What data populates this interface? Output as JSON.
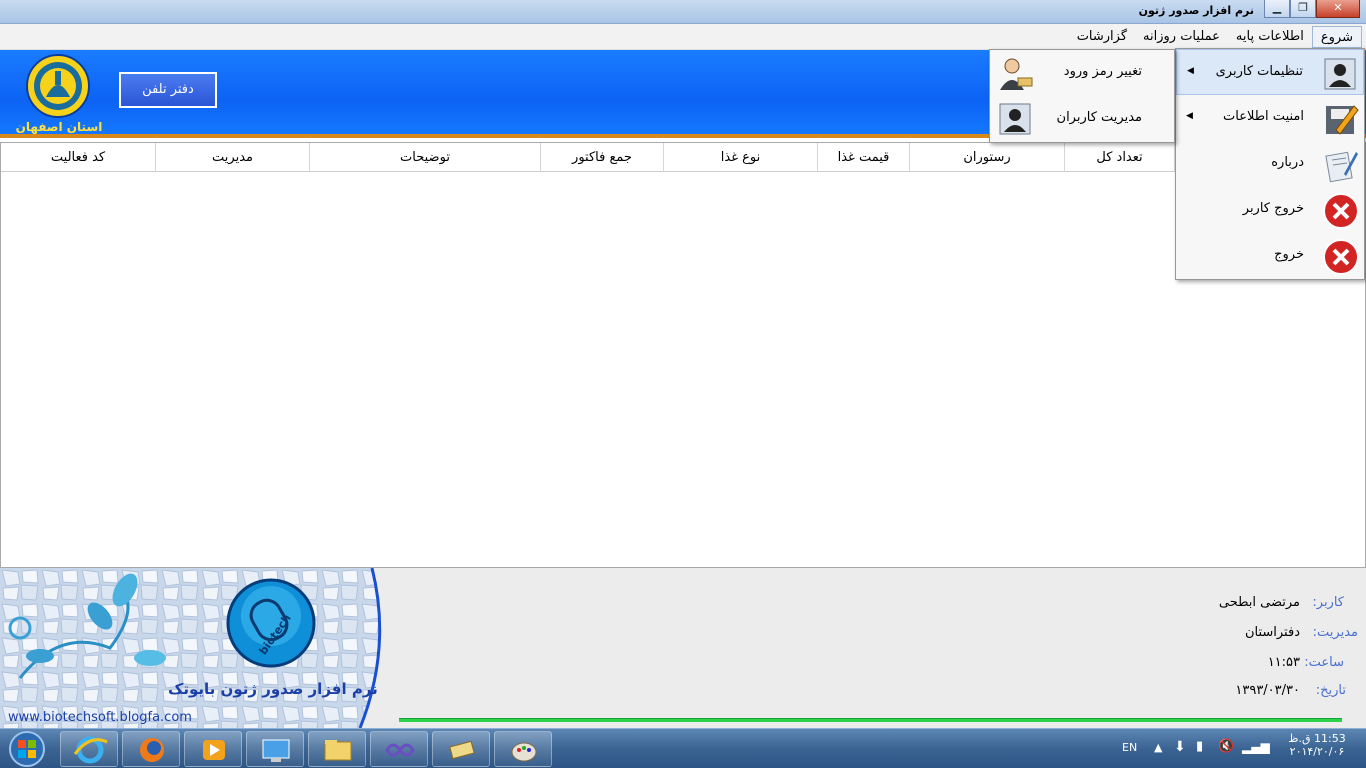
{
  "window": {
    "title": "نرم افزار صدور ژتون",
    "minimize_glyph": "▁",
    "maximize_glyph": "❐",
    "close_glyph": "✕"
  },
  "menubar": {
    "items": [
      {
        "label": "شروع"
      },
      {
        "label": "اطلاعات پایه"
      },
      {
        "label": "عملیات روزانه"
      },
      {
        "label": "گزارشات"
      }
    ]
  },
  "banner": {
    "logo_caption": "استان اصفهان",
    "phone_button_label": "دفتر تلفن"
  },
  "grid": {
    "columns": [
      {
        "label": "کد فعالیت"
      },
      {
        "label": "مدیریت"
      },
      {
        "label": "توضیحات"
      },
      {
        "label": "جمع فاکتور"
      },
      {
        "label": "نوع غذا"
      },
      {
        "label": "قیمت غذا"
      },
      {
        "label": "رستوران"
      },
      {
        "label": "تعداد کل"
      }
    ]
  },
  "start_menu": {
    "items": [
      {
        "label": "تنظیمات کاربری",
        "icon": "user-settings-icon",
        "has_submenu": true
      },
      {
        "label": "امنیت اطلاعات",
        "icon": "security-icon",
        "has_submenu": true
      },
      {
        "label": "درباره",
        "icon": "about-icon",
        "has_submenu": false
      },
      {
        "label": "خروج کاربر",
        "icon": "logout-icon",
        "has_submenu": false
      },
      {
        "label": "خروج",
        "icon": "exit-icon",
        "has_submenu": false
      }
    ],
    "submenu": [
      {
        "label": "تغییر رمز ورود",
        "icon": "change-password-icon"
      },
      {
        "label": "مدیریت کاربران",
        "icon": "manage-users-icon"
      }
    ]
  },
  "brand": {
    "product_name": "نرم افزار صدور ژتون بایوتک",
    "badge_text": "biotech",
    "website": "www.biotechsoft.blogfa.com"
  },
  "status": {
    "user_label": "کاربر:",
    "user_value": "مرتضی ابطحی",
    "management_label": "مدیریت:",
    "management_value": "دفتراستان",
    "time_label": "ساعت:",
    "time_value": "۱۱:۵۳",
    "date_label": "تاریخ:",
    "date_value": "۱۳۹۳/۰۳/۳۰"
  },
  "taskbar": {
    "language": "EN",
    "clock_time": "11:53 ق.ظ",
    "clock_date": "۲۰۱۴/۲۰/۰۶"
  },
  "colors": {
    "banner_blue": "#0d63f4",
    "accent_orange": "#d78a1b",
    "progress_green": "#2bd44a",
    "label_blue": "#4a6fd0"
  }
}
